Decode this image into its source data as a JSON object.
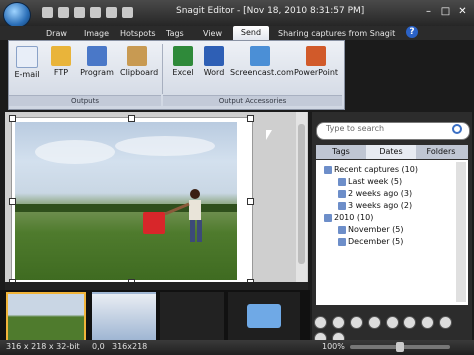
{
  "window": {
    "title": "Snagit Editor - [Nov 18, 2010 8:31:57 PM]",
    "help_glyph": "?"
  },
  "tabs": [
    {
      "label": "Draw"
    },
    {
      "label": "Image"
    },
    {
      "label": "Hotspots"
    },
    {
      "label": "Tags"
    },
    {
      "label": "View"
    },
    {
      "label": "Send"
    },
    {
      "label": "Sharing captures from Snagit"
    }
  ],
  "ribbon": {
    "outputs_group_label": "Outputs",
    "accessories_group_label": "Output Accessories",
    "outputs": [
      {
        "label": "E-mail",
        "icon": "email-icon"
      },
      {
        "label": "FTP",
        "icon": "ftp-icon"
      },
      {
        "label": "Program",
        "icon": "program-icon"
      },
      {
        "label": "Clipboard",
        "icon": "clipboard-icon"
      }
    ],
    "accessories": [
      {
        "label": "Excel",
        "icon": "excel-icon"
      },
      {
        "label": "Word",
        "icon": "word-icon"
      },
      {
        "label": "Screencast.com",
        "icon": "screencast-icon"
      },
      {
        "label": "PowerPoint",
        "icon": "powerpoint-icon"
      }
    ]
  },
  "search": {
    "placeholder": "Type to search"
  },
  "panel_tabs": [
    {
      "label": "Tags"
    },
    {
      "label": "Dates"
    },
    {
      "label": "Folders"
    }
  ],
  "tree": [
    {
      "label": "Recent captures (10)",
      "level": 0
    },
    {
      "label": "Last week (5)",
      "level": 1
    },
    {
      "label": "2 weeks ago (3)",
      "level": 1
    },
    {
      "label": "3 weeks ago (2)",
      "level": 1
    },
    {
      "label": "2010 (10)",
      "level": 0
    },
    {
      "label": "November (5)",
      "level": 1
    },
    {
      "label": "December (5)",
      "level": 1
    }
  ],
  "status": {
    "dimensions": "316 x 218 x 32-bit",
    "coords": "0,0",
    "size": "316x218",
    "zoom": "100%"
  },
  "colors": {
    "accent": "#2b62c6",
    "chrome_dark": "#1b1b1b",
    "ribbon_light": "#eef1f6"
  }
}
